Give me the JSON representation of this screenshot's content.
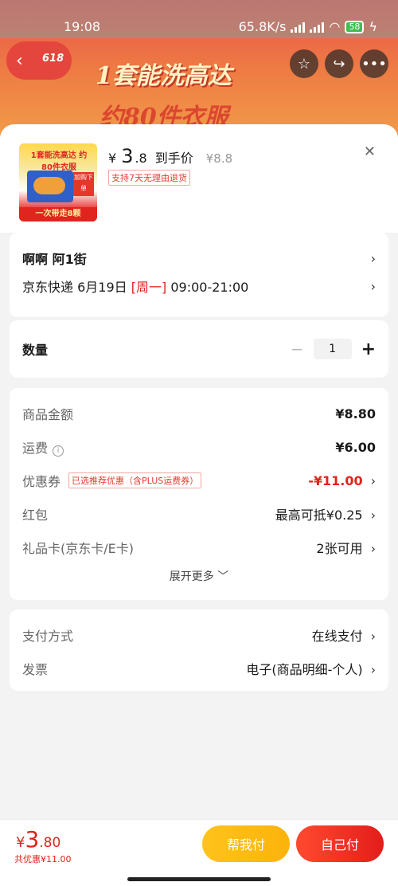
{
  "status_bar": {
    "time": "19:08",
    "net_speed": "65.8K/s",
    "battery": "58"
  },
  "banner": {
    "badge": "618",
    "headline": "1套能洗高达",
    "subline": "约80件衣服"
  },
  "product": {
    "price_yen": "¥",
    "price_int": "3",
    "price_dec": ".8",
    "price_label": "到手价",
    "original_price": "¥8.8",
    "return_tag": "支持7天无理由退货",
    "thumb_headline": "1套能洗高达 约80件衣服",
    "thumb_tag": "加购下单",
    "thumb_strip": "一次带走8颗"
  },
  "address": {
    "name": "啊啊  阿1街",
    "delivery_prefix": "京东快递 6月19日",
    "delivery_day": "[周一]",
    "delivery_time": "09:00-21:00"
  },
  "quantity": {
    "label": "数量",
    "value": "1",
    "minus": "−",
    "plus": "+"
  },
  "costs": {
    "goods_label": "商品金额",
    "goods_value": "¥8.80",
    "shipping_label": "运费",
    "shipping_value": "¥6.00",
    "coupon_label": "优惠券",
    "coupon_tag": "已选推荐优惠（含PLUS运费券）",
    "coupon_value": "-¥11.00",
    "redpacket_label": "红包",
    "redpacket_value": "最高可抵¥0.25",
    "giftcard_label": "礼品卡(京东卡/E卡)",
    "giftcard_value": "2张可用",
    "expand_label": "展开更多"
  },
  "payment": {
    "method_label": "支付方式",
    "method_value": "在线支付",
    "invoice_label": "发票",
    "invoice_value": "电子(商品明细-个人)"
  },
  "footer": {
    "total_yen": "¥",
    "total_int": "3",
    "total_dec": ".80",
    "saved": "共优惠¥11.00",
    "help_pay": "帮我付",
    "self_pay": "自己付"
  },
  "colors": {
    "accent_red": "#e2231a",
    "help_yellow": "#fbb30a"
  }
}
